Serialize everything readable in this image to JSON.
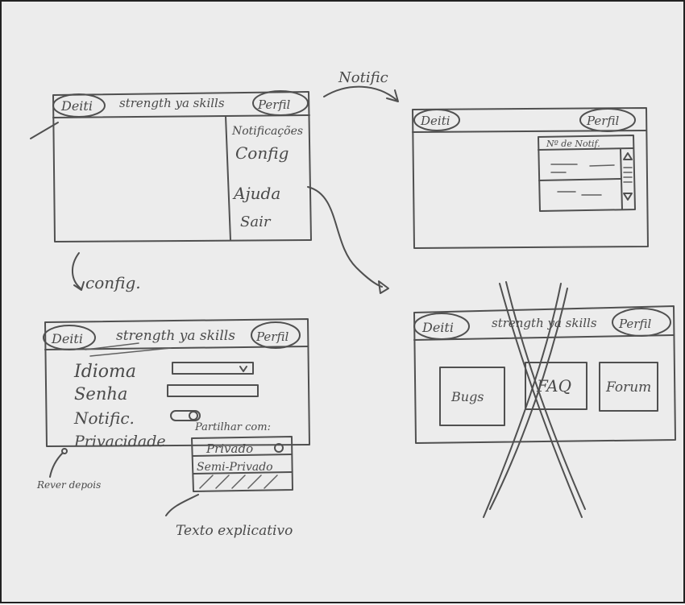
{
  "sketch1": {
    "logo": "Deiti",
    "title": "strength ya skills",
    "profile": "Perfil",
    "menu": [
      "Notificações",
      "Config",
      "Ajuda",
      "Sair"
    ]
  },
  "arrows": {
    "notifications": "Notific",
    "config": "config."
  },
  "sketch2": {
    "logo": "Deiti",
    "profile": "Perfil",
    "panel_header": "Nº de Notif."
  },
  "sketch3": {
    "logo": "Deiti",
    "title": "strength ya skills",
    "profile": "Perfil",
    "rows": {
      "language": "Idioma",
      "password": "Senha",
      "notifications": "Notific.",
      "privacy": "Privacidade"
    },
    "share_label": "Partilhar com:",
    "privacy_options": [
      "Privado",
      "Semi-Privado"
    ],
    "note_left": "Rever depois",
    "note_bottom": "Texto explicativo"
  },
  "sketch4": {
    "logo": "Deiti",
    "title": "strength ya skills",
    "profile": "Perfil",
    "buttons": [
      "Bugs",
      "FAQ",
      "Forum"
    ]
  }
}
